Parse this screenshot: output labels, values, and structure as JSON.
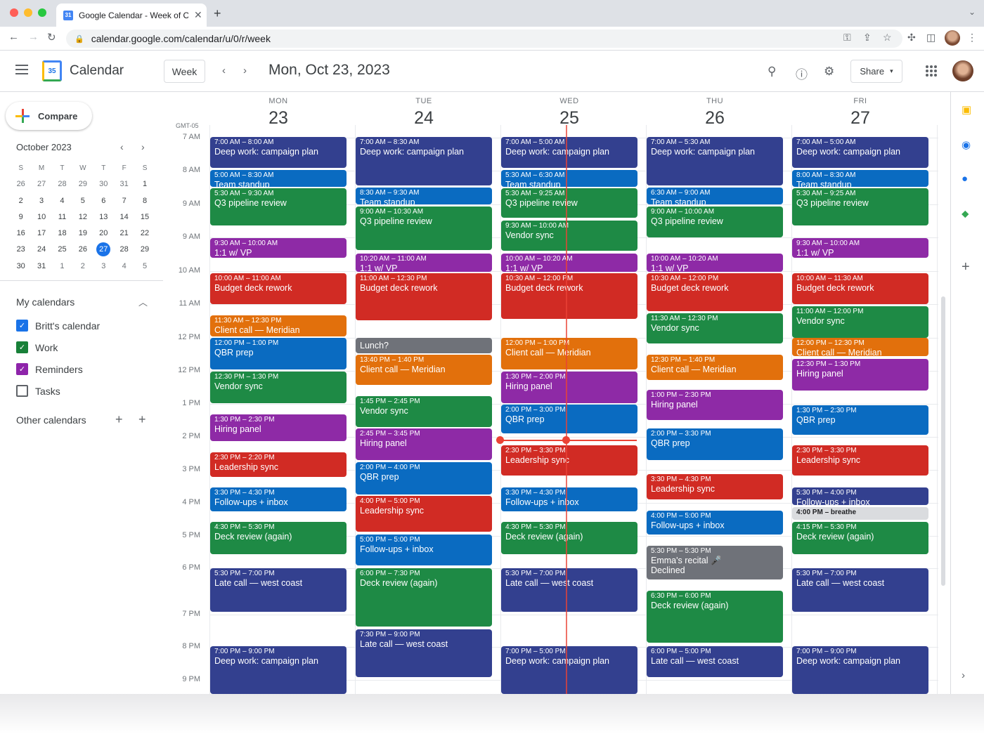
{
  "browser": {
    "tab_title": "Google Calendar - Week of Oct",
    "url": "calendar.google.com/calendar/u/0/r/week"
  },
  "header": {
    "app_name": "Calendar",
    "logo_day": "35",
    "view": "Week",
    "date": "Mon, Oct 23, 2023",
    "share": "Share"
  },
  "sidebar": {
    "compose": "Compare",
    "mini_title": "October 2023",
    "weekday_heads": [
      "S",
      "M",
      "T",
      "W",
      "T",
      "F",
      "S"
    ],
    "weeks": [
      [
        "26",
        "27",
        "28",
        "29",
        "30",
        "31",
        "1"
      ],
      [
        "2",
        "3",
        "4",
        "5",
        "6",
        "7",
        "8"
      ],
      [
        "9",
        "10",
        "11",
        "12",
        "13",
        "14",
        "15"
      ],
      [
        "16",
        "17",
        "18",
        "19",
        "20",
        "21",
        "22"
      ],
      [
        "23",
        "24",
        "25",
        "26",
        "27",
        "28",
        "29"
      ],
      [
        "30",
        "31",
        "1",
        "2",
        "3",
        "4",
        "5"
      ]
    ],
    "today": "27",
    "my_calendars": "My calendars",
    "calendars": [
      {
        "name": "Britt's calendar",
        "color": "#1a73e8",
        "checked": true
      },
      {
        "name": "Work",
        "color": "#188038",
        "checked": true
      },
      {
        "name": "Reminders",
        "color": "#8e24aa",
        "checked": true
      },
      {
        "name": "Tasks",
        "color": "#5f6368",
        "checked": false
      }
    ],
    "other_calendars": "Other calendars"
  },
  "grid": {
    "gmt": "GMT-05",
    "time_labels": [
      "7 AM",
      "8 AM",
      "9 AM",
      "9 AM",
      "10 AM",
      "11 AM",
      "12 PM",
      "12 PM",
      "1 PM",
      "2 PM",
      "3 PM",
      "4 PM",
      "5 PM",
      "6 PM",
      "7 PM",
      "8 PM",
      "9 PM"
    ],
    "days": [
      {
        "name": "MON",
        "num": "23"
      },
      {
        "name": "TUE",
        "num": "24"
      },
      {
        "name": "WED",
        "num": "25"
      },
      {
        "name": "THU",
        "num": "26"
      },
      {
        "name": "FRI",
        "num": "27"
      }
    ]
  },
  "colors": {
    "navy": "#33408f",
    "blue": "#0a6bc1",
    "green": "#1e8a45",
    "purple": "#8e2aa6",
    "red": "#d12b24",
    "orange": "#e2700c",
    "gray": "#6f7279",
    "lightgray": "#dadcdf"
  },
  "events": [
    [
      {
        "time": "7:00 AM – 8:00 AM",
        "title": "Deep work: campaign plan",
        "color": "navy"
      },
      {
        "time": "5:00 AM – 8:30 AM",
        "title": "Team standup",
        "color": "blue"
      },
      {
        "time": "5:30 AM – 9:30 AM",
        "title": "Q3 pipeline review",
        "color": "green"
      },
      {
        "time": "9:30 AM – 10:00 AM",
        "title": "1:1 w/ VP",
        "color": "purple"
      },
      {
        "time": "10:00 AM – 11:00 AM",
        "title": "Budget deck rework",
        "color": "red"
      },
      {
        "time": "11:30 AM – 12:30 PM",
        "title": "Client call — Meridian",
        "color": "orange"
      },
      {
        "time": "12:00 PM – 1:00 PM",
        "title": "QBR prep",
        "color": "blue"
      },
      {
        "time": "12:30 PM – 1:30 PM",
        "title": "Vendor sync",
        "color": "green"
      },
      {
        "time": "1:30 PM – 2:30 PM",
        "title": "Hiring panel",
        "color": "purple"
      },
      {
        "time": "2:30 PM – 2:20 PM",
        "title": "Leadership sync",
        "color": "red"
      },
      {
        "time": "3:30 PM – 4:30 PM",
        "title": "Follow-ups + inbox",
        "color": "blue"
      },
      {
        "time": "4:30 PM – 5:30 PM",
        "title": "Deck review (again)",
        "color": "green"
      },
      {
        "time": "5:30 PM – 7:00 PM",
        "title": "Late call — west coast",
        "color": "navy"
      },
      {
        "time": "7:00 PM – 9:00 PM",
        "title": "Deep work: campaign plan",
        "color": "navy"
      }
    ],
    [
      {
        "time": "7:00 AM – 8:30 AM",
        "title": "Deep work: campaign plan",
        "color": "navy"
      },
      {
        "time": "8:30 AM – 9:30 AM",
        "title": "Team standup",
        "color": "blue"
      },
      {
        "time": "9:00 AM – 10:30 AM",
        "title": "Q3 pipeline review",
        "color": "green"
      },
      {
        "time": "10:20 AM – 11:00 AM",
        "title": "1:1 w/ VP",
        "color": "purple"
      },
      {
        "time": "11:00 AM – 12:30 PM",
        "title": "Budget deck rework",
        "color": "red"
      },
      {
        "time": "",
        "title": "Lunch?",
        "color": "gray"
      },
      {
        "time": "13:40 PM – 1:40 PM",
        "title": "Client call — Meridian",
        "color": "orange"
      },
      {
        "time": "1:45 PM – 2:45 PM",
        "title": "Vendor sync",
        "color": "green"
      },
      {
        "time": "2:45 PM – 3:45 PM",
        "title": "Hiring panel",
        "color": "purple"
      },
      {
        "time": "2:00 PM – 4:00 PM",
        "title": "QBR prep",
        "color": "blue"
      },
      {
        "time": "4:00 PM – 5:00 PM",
        "title": "Leadership sync",
        "color": "red"
      },
      {
        "time": "5:00 PM – 5:00 PM",
        "title": "Follow-ups + inbox",
        "color": "blue"
      },
      {
        "time": "6:00 PM – 7:30 PM",
        "title": "Deck review (again)",
        "color": "green"
      },
      {
        "time": "7:30 PM – 9:00 PM",
        "title": "Late call — west coast",
        "color": "navy"
      }
    ],
    [
      {
        "time": "7:00 AM – 5:00 AM",
        "title": "Deep work: campaign plan",
        "color": "navy"
      },
      {
        "time": "5:30 AM – 6:30 AM",
        "title": "Team standup",
        "color": "blue"
      },
      {
        "time": "5:30 AM – 9:25 AM",
        "title": "Q3 pipeline review",
        "color": "green"
      },
      {
        "time": "9:30 AM – 10:00 AM",
        "title": "Vendor sync",
        "color": "green"
      },
      {
        "time": "10:00 AM – 10:20 AM",
        "title": "1:1 w/ VP",
        "color": "purple"
      },
      {
        "time": "10:30 AM – 12:00 PM",
        "title": "Budget deck rework",
        "color": "red"
      },
      {
        "time": "12:00 PM – 1:00 PM",
        "title": "Client call — Meridian",
        "color": "orange"
      },
      {
        "time": "1:30 PM – 2:00 PM",
        "title": "Hiring panel",
        "color": "purple"
      },
      {
        "time": "2:00 PM – 3:00 PM",
        "title": "QBR prep",
        "color": "blue"
      },
      {
        "time": "2:30 PM – 3:30 PM",
        "title": "Leadership sync",
        "color": "red"
      },
      {
        "time": "3:30 PM – 4:30 PM",
        "title": "Follow-ups + inbox",
        "color": "blue"
      },
      {
        "time": "4:30 PM – 5:30 PM",
        "title": "Deck review (again)",
        "color": "green"
      },
      {
        "time": "5:30 PM – 7:00 PM",
        "title": "Late call — west coast",
        "color": "navy"
      },
      {
        "time": "7:00 PM – 5:00 PM",
        "title": "Deep work: campaign plan",
        "color": "navy"
      }
    ],
    [
      {
        "time": "7:00 AM – 5:30 AM",
        "title": "Deep work: campaign plan",
        "color": "navy"
      },
      {
        "time": "6:30 AM – 9:00 AM",
        "title": "Team standup",
        "color": "blue"
      },
      {
        "time": "9:00 AM – 10:00 AM",
        "title": "Q3 pipeline review",
        "color": "green"
      },
      {
        "time": "10:00 AM – 10:20 AM",
        "title": "1:1 w/ VP",
        "color": "purple"
      },
      {
        "time": "10:30 AM – 12:00 PM",
        "title": "Budget deck rework",
        "color": "red"
      },
      {
        "time": "11:30 AM – 12:30 PM",
        "title": "Vendor sync",
        "color": "green"
      },
      {
        "time": "12:30 PM – 1:40 PM",
        "title": "Client call — Meridian",
        "color": "orange"
      },
      {
        "time": "1:00 PM – 2:30 PM",
        "title": "Hiring panel",
        "color": "purple"
      },
      {
        "time": "2:00 PM – 3:30 PM",
        "title": "QBR prep",
        "color": "blue"
      },
      {
        "time": "3:30 PM – 4:30 PM",
        "title": "Leadership sync",
        "color": "red"
      },
      {
        "time": "4:00 PM – 5:00 PM",
        "title": "Follow-ups + inbox",
        "color": "blue"
      },
      {
        "time": "5:30 PM – 5:30 PM",
        "title": "Emma's recital 🎤",
        "extra": "Declined",
        "color": "gray"
      },
      {
        "time": "6:30 PM – 6:00 PM",
        "title": "Deck review (again)",
        "color": "green"
      },
      {
        "time": "6:00 PM – 5:00 PM",
        "title": "Late call — west coast",
        "color": "navy"
      }
    ],
    [
      {
        "time": "7:00 AM – 5:00 AM",
        "title": "Deep work: campaign plan",
        "color": "navy"
      },
      {
        "time": "8:00 AM – 8:30 AM",
        "title": "Team standup",
        "color": "blue"
      },
      {
        "time": "5:30 AM – 9:25 AM",
        "title": "Q3 pipeline review",
        "color": "green"
      },
      {
        "time": "9:30 AM – 10:00 AM",
        "title": "1:1 w/ VP",
        "color": "purple"
      },
      {
        "time": "10:00 AM – 11:30 AM",
        "title": "Budget deck rework",
        "color": "red"
      },
      {
        "time": "11:00 AM – 12:00 PM",
        "title": "Vendor sync",
        "color": "green"
      },
      {
        "time": "12:00 PM – 12:30 PM",
        "title": "Client call — Meridian",
        "color": "orange"
      },
      {
        "time": "12:30 PM – 1:30 PM",
        "title": "Hiring panel",
        "color": "purple"
      },
      {
        "time": "1:30 PM – 2:30 PM",
        "title": "QBR prep",
        "color": "blue"
      },
      {
        "time": "2:30 PM – 3:30 PM",
        "title": "Leadership sync",
        "color": "red"
      },
      {
        "time": "5:30 PM – 4:00 PM",
        "title": "Follow-ups + inbox",
        "color": "navy"
      },
      {
        "time": "4:00 PM – breathe",
        "title": "",
        "color": "lightgray"
      },
      {
        "time": "4:15 PM – 5:30 PM",
        "title": "Deck review (again)",
        "color": "green"
      },
      {
        "time": "5:30 PM – 7:00 PM",
        "title": "Late call — west coast",
        "color": "navy"
      },
      {
        "time": "7:00 PM – 9:00 PM",
        "title": "Deep work: campaign plan",
        "color": "navy"
      }
    ]
  ]
}
